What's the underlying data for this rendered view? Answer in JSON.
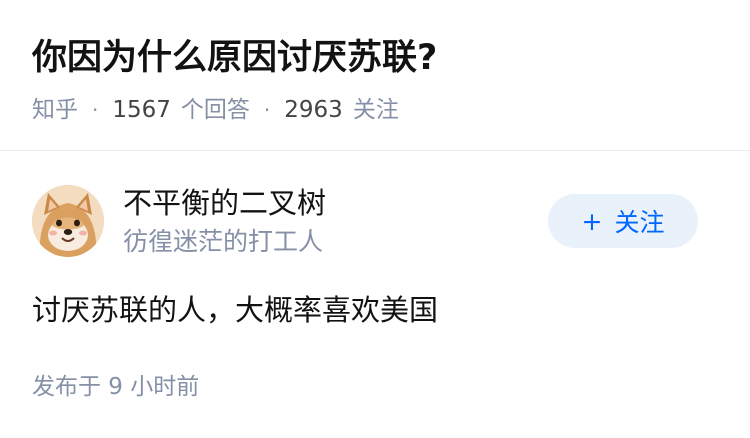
{
  "question": {
    "title": "你因为什么原因讨厌苏联?",
    "source": "知乎",
    "answer_count": "1567",
    "answer_label": "个回答",
    "follower_count": "2963",
    "follower_label": "关注",
    "separator": "·"
  },
  "answer": {
    "author": {
      "name": "不平衡的二叉树",
      "bio": "彷徨迷茫的打工人",
      "avatar_icon": "shiba-dog-avatar-icon"
    },
    "follow_button": {
      "plus": "+",
      "label": "关注"
    },
    "content": "讨厌苏联的人，大概率喜欢美国",
    "published": "发布于 9 小时前"
  },
  "colors": {
    "title": "#121212",
    "meta_gray": "#8590a6",
    "accent_blue": "#0066ff",
    "follow_bg": "#e9f1fb",
    "divider": "#ececec"
  }
}
